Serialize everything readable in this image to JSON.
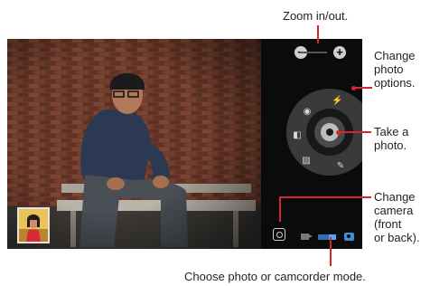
{
  "callouts": {
    "zoom": "Zoom in/out.",
    "photo_options": [
      "Change",
      "photo",
      "options."
    ],
    "take_photo": [
      "Take a",
      "photo."
    ],
    "change_camera": [
      "Change",
      "camera",
      "(front",
      "or back)."
    ],
    "mode": "Choose photo or camcorder mode."
  },
  "controls": {
    "zoom_out_symbol": "−",
    "zoom_in_symbol": "+"
  },
  "colors": {
    "leader": "#d7262e",
    "mode_accent": "#3b8fd8"
  },
  "icons": [
    "minus-icon",
    "plus-icon",
    "flash-icon",
    "focus-icon",
    "scene-icon",
    "gallery-icon",
    "settings-icon",
    "shutter-icon",
    "switch-camera-icon",
    "video-icon",
    "camera-icon"
  ]
}
